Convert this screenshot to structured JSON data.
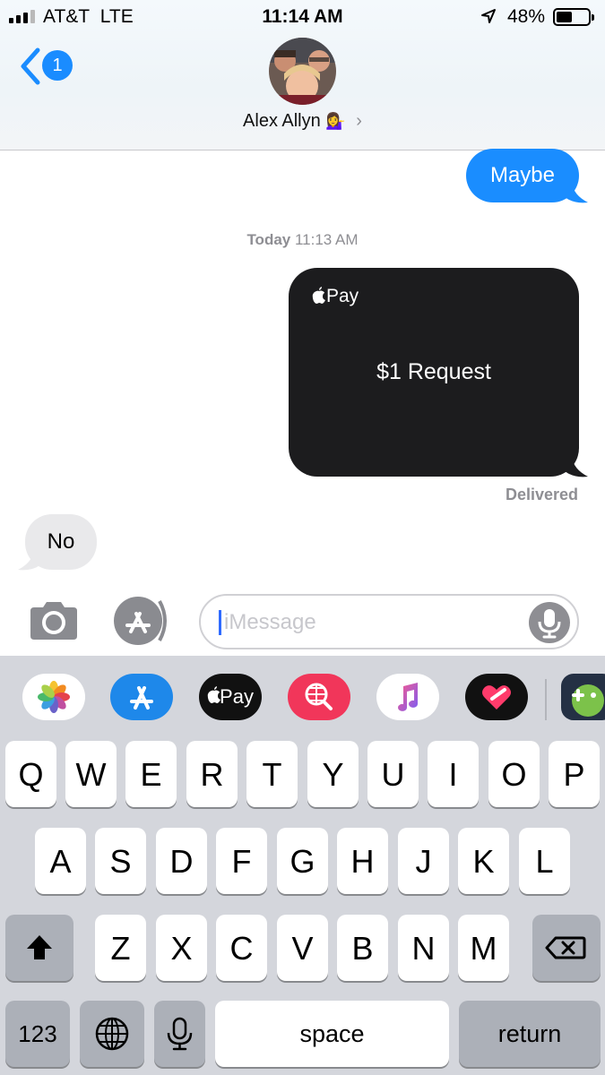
{
  "status_bar": {
    "carrier": "AT&T",
    "network": "LTE",
    "time": "11:14 AM",
    "battery_percent": "48%",
    "battery_level": 0.48
  },
  "header": {
    "back_badge_count": "1",
    "contact_name": "Alex Allyn",
    "contact_emoji": "💁‍♀️"
  },
  "messages": {
    "outgoing_text": "Maybe",
    "timestamp_day": "Today",
    "timestamp_time": "11:13 AM",
    "apple_pay_brand": "Pay",
    "apple_pay_request": "$1 Request",
    "delivery_status": "Delivered",
    "incoming_text": "No"
  },
  "input_bar": {
    "placeholder": "iMessage"
  },
  "app_drawer": {
    "apps": [
      "photos-icon",
      "app-store-icon",
      "apple-pay-icon",
      "web-search-icon",
      "music-icon",
      "digital-touch-icon",
      "game-icon"
    ],
    "apple_pay_label": "Pay"
  },
  "keyboard": {
    "row1": [
      "Q",
      "W",
      "E",
      "R",
      "T",
      "Y",
      "U",
      "I",
      "O",
      "P"
    ],
    "row2": [
      "A",
      "S",
      "D",
      "F",
      "G",
      "H",
      "J",
      "K",
      "L"
    ],
    "row3": [
      "Z",
      "X",
      "C",
      "V",
      "B",
      "N",
      "M"
    ],
    "numbers_key": "123",
    "space_key": "space",
    "return_key": "return"
  },
  "colors": {
    "imessage_blue": "#1a8dff",
    "incoming_gray": "#e9e9eb",
    "apple_pay_card": "#1c1c1e",
    "keyboard_bg": "#d4d6dc"
  }
}
